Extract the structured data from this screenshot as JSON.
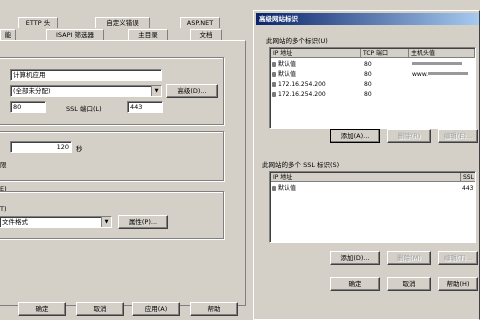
{
  "props": {
    "tabs_top": [
      "ETTP 头",
      "自定义错误",
      "ASP.NET"
    ],
    "tabs_bottom": [
      "能",
      "ISAPI 筛选器",
      "主目录",
      "文档"
    ],
    "description_value": "计算机应用",
    "ip_select_value": "(全部未分配)",
    "advanced_button": "高级(D)...",
    "tcp_port_value": "80",
    "ssl_port_label": "SSL 端口(L)",
    "ssl_port_value": "443",
    "timeout_value": "120",
    "timeout_unit": "秒",
    "timeout_label": "限",
    "logging_label": "E)",
    "log_format_label": "T)",
    "log_format_value": "文件格式",
    "properties_button": "属性(P)...",
    "buttons": {
      "ok": "确定",
      "cancel": "取消",
      "apply": "应用(A)",
      "help": "帮助"
    }
  },
  "dialog": {
    "title": "高级网站标识",
    "identities_label": "此网站的多个标识(U)",
    "columns": [
      "IP 地址",
      "TCP 端口",
      "主机头值"
    ],
    "rows": [
      {
        "ip": "默认值",
        "port": "80",
        "host": "www.",
        "host_hidden": true
      },
      {
        "ip": "默认值",
        "port": "80",
        "host": "www.",
        "host_hidden": true
      },
      {
        "ip": "172.16.254.200",
        "port": "80",
        "host": "",
        "host_hidden": false
      },
      {
        "ip": "172.16.254.200",
        "port": "80",
        "host": "",
        "host_hidden": false
      }
    ],
    "add_button": "添加(A)...",
    "remove_button": "删除(R)",
    "edit_button": "编辑(E)...",
    "ssl_label": "此网站的多个 SSL 标识(S)",
    "ssl_columns": [
      "IP 地址",
      "SSL"
    ],
    "ssl_rows": [
      {
        "ip": "默认值",
        "port": "443"
      }
    ],
    "ssl_add_button": "添加(D)...",
    "ssl_remove_button": "删除(M)",
    "ssl_edit_button": "编辑(T)...",
    "ok_button": "确定",
    "cancel_button": "取消",
    "help_button": "帮助(H)"
  }
}
